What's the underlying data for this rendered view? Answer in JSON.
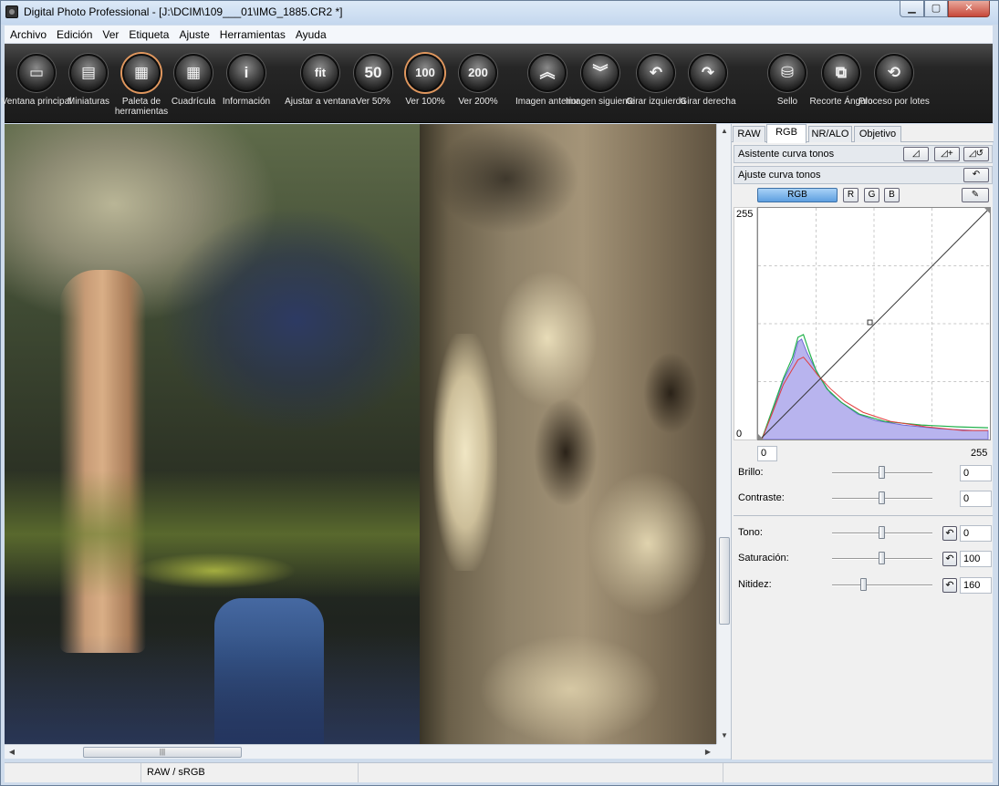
{
  "window": {
    "title": "Digital Photo Professional - [J:\\DCIM\\109___01\\IMG_1885.CR2 *]",
    "min_glyph": "▁",
    "max_glyph": "▢",
    "close_glyph": "✕"
  },
  "menu": [
    "Archivo",
    "Edición",
    "Ver",
    "Etiqueta",
    "Ajuste",
    "Herramientas",
    "Ayuda"
  ],
  "toolbar": [
    {
      "label": "Ventana principal",
      "icon": "main-window-icon",
      "glyph": "▭"
    },
    {
      "label": "Miniaturas",
      "icon": "thumbnails-icon",
      "glyph": "▤"
    },
    {
      "label": "Paleta de herramientas",
      "icon": "tool-palette-icon",
      "glyph": "▦",
      "active": true
    },
    {
      "label": "Cuadrícula",
      "icon": "grid-icon",
      "glyph": "▦"
    },
    {
      "label": "Información",
      "icon": "info-icon",
      "glyph": "i"
    },
    {
      "label": "Ajustar a ventana",
      "icon": "fit-icon",
      "glyph": "fit"
    },
    {
      "label": "Ver 50%",
      "icon": "zoom-50-icon",
      "glyph": "50"
    },
    {
      "label": "Ver 100%",
      "icon": "zoom-100-icon",
      "glyph": "100",
      "active": true
    },
    {
      "label": "Ver 200%",
      "icon": "zoom-200-icon",
      "glyph": "200"
    },
    {
      "label": "Imagen anterior",
      "icon": "previous-image-icon",
      "glyph": "︽"
    },
    {
      "label": "Imagen siguiente",
      "icon": "next-image-icon",
      "glyph": "︾"
    },
    {
      "label": "Girar izquierda",
      "icon": "rotate-left-icon",
      "glyph": "↶"
    },
    {
      "label": "Girar derecha",
      "icon": "rotate-right-icon",
      "glyph": "↷"
    },
    {
      "label": "Sello",
      "icon": "stamp-icon",
      "glyph": "⛁"
    },
    {
      "label": "Recorte Ángulo",
      "icon": "crop-angle-icon",
      "glyph": "⧉"
    },
    {
      "label": "Proceso por lotes",
      "icon": "batch-process-icon",
      "glyph": "⟲"
    }
  ],
  "palette": {
    "tabs": [
      "RAW",
      "RGB",
      "NR/ALO",
      "Objetivo"
    ],
    "active_tab": "RGB",
    "curve_assist": "Asistente curva tonos",
    "curve_adjust": "Ajuste curva tonos",
    "channels": [
      "RGB",
      "R",
      "G",
      "B"
    ],
    "active_channel": "RGB",
    "graph": {
      "y_max": "255",
      "y_min": "0",
      "x_min": "0",
      "x_max": "255"
    },
    "sliders": [
      {
        "label": "Brillo:",
        "value": "0",
        "reset": false,
        "position": 0.5
      },
      {
        "label": "Contraste:",
        "value": "0",
        "reset": false,
        "position": 0.5
      },
      {
        "label": "Tono:",
        "value": "0",
        "reset": true,
        "position": 0.5
      },
      {
        "label": "Saturación:",
        "value": "100",
        "reset": true,
        "position": 0.5
      },
      {
        "label": "Nitidez:",
        "value": "160",
        "reset": true,
        "position": 0.32
      }
    ]
  },
  "status": {
    "color_mode": "RAW / sRGB"
  },
  "colors": {
    "toolbar_bg": "#1b1b1b",
    "active_ring": "#e0975e",
    "histogram_fill": "#b8b4ee"
  }
}
